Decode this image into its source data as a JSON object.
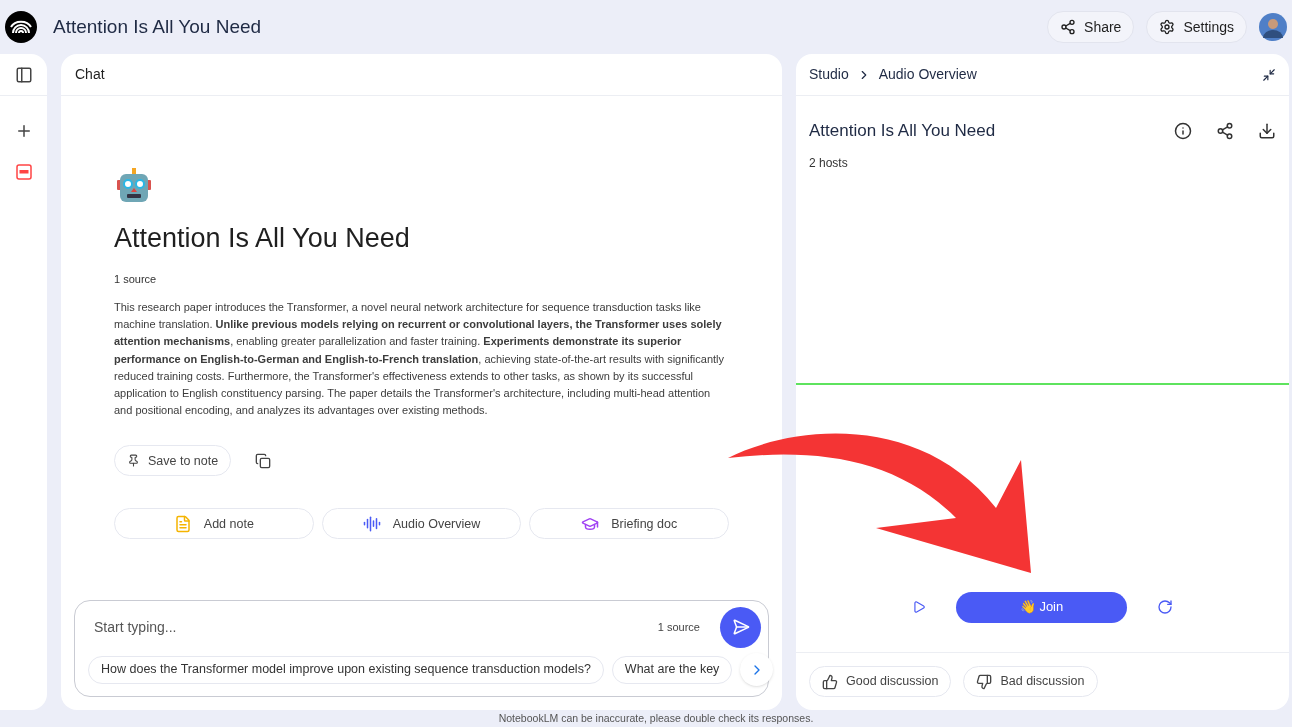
{
  "header": {
    "title": "Attention Is All You Need",
    "buttons": [
      "Share",
      "Settings"
    ]
  },
  "chat": {
    "title": "Chat",
    "notebook_title": "Attention Is All You Need",
    "source_count": "1 source",
    "summary": "This research paper introduces the Transformer, a novel neural network architecture for sequence transduction tasks like machine translation. **Unlike previous models relying on recurrent or convolutional layers, the Transformer uses solely attention mechanisms**, enabling greater parallelization and faster training. **Experiments demonstrate its superior performance on English-to-German and English-to-French translation**, achieving state-of-the-art results with significantly reduced training costs. Furthermore, the Transformer's effectiveness extends to other tasks, as shown by its successful application to English constituency parsing. The paper details the Transformer's architecture, including multi-head attention and positional encoding, and analyzes its advantages over existing methods.",
    "save_button": "Save to note",
    "actions": [
      {
        "kind": "note",
        "label": "Add note"
      },
      {
        "kind": "audio",
        "label": "Audio Overview"
      },
      {
        "kind": "briefing",
        "label": "Briefing doc"
      }
    ],
    "input": {
      "placeholder": "Start typing...",
      "source_count": "1 source"
    },
    "suggestions": [
      "How does the Transformer model improve upon existing sequence transduction models?",
      "What are the key"
    ]
  },
  "studio": {
    "breadcrumb": [
      "Studio",
      "Audio Overview"
    ],
    "title": "Attention Is All You Need",
    "hosts": "2 hosts",
    "join_button": "👋 Join",
    "feedback": [
      {
        "kind": "good",
        "label": "Good discussion"
      },
      {
        "kind": "bad",
        "label": "Bad discussion"
      }
    ]
  },
  "disclaimer": "NotebookLM can be inaccurate, please double check its responses."
}
